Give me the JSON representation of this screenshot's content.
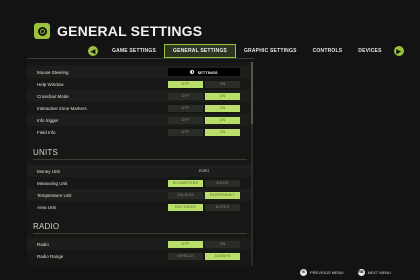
{
  "header": {
    "title": "GENERAL SETTINGS"
  },
  "tabs": {
    "left_nav": "◂",
    "right_nav": "▸",
    "items": [
      {
        "label": "GAME SETTINGS",
        "active": false
      },
      {
        "label": "GENERAL SETTINGS",
        "active": true
      },
      {
        "label": "GRAPHIC SETTINGS",
        "active": false
      },
      {
        "label": "CONTROLS",
        "active": false
      },
      {
        "label": "DEVICES",
        "active": false
      }
    ]
  },
  "general": {
    "mouse_steering": {
      "label": "Mouse Steering",
      "button": "SETTINGS"
    },
    "help_window": {
      "label": "Help Window",
      "off": "OFF",
      "on": "ON",
      "selected": "off"
    },
    "crosshair_mode": {
      "label": "Crosshair Mode",
      "off": "OFF",
      "on": "ON",
      "selected": "on"
    },
    "interactive_zone_markers": {
      "label": "Interactive Zone Markers",
      "off": "OFF",
      "on": "ON",
      "selected": "on"
    },
    "info_trigger": {
      "label": "Info trigger",
      "off": "OFF",
      "on": "ON",
      "selected": "on"
    },
    "field_info": {
      "label": "Field Info",
      "off": "OFF",
      "on": "ON",
      "selected": "on"
    }
  },
  "units": {
    "heading": "UNITS",
    "money_unit": {
      "label": "Money Unit",
      "value": "EURO"
    },
    "measuring_unit": {
      "label": "Measuring Unit",
      "a": "KILOMETERS",
      "b": "MILES",
      "selected": "a"
    },
    "temperature_unit": {
      "label": "Temperature Unit",
      "a": "CELSIUS",
      "b": "FAHRENHEIT",
      "selected": "b"
    },
    "area_unit": {
      "label": "Area Unit",
      "a": "HECTARES",
      "b": "ACRES",
      "selected": "a"
    }
  },
  "radio": {
    "heading": "RADIO",
    "radio": {
      "label": "Radio",
      "off": "OFF",
      "on": "ON",
      "selected": "off"
    },
    "radio_range": {
      "label": "Radio Range",
      "a": "VEHICLE",
      "b": "ALWAYS",
      "selected": "b"
    }
  },
  "footer": {
    "previous_menu": {
      "key": "B",
      "label": "PREVIOUS MENU"
    },
    "next_menu": {
      "key": "RB",
      "label": "NEXT MENU"
    }
  },
  "colors": {
    "accent": "#9ac23c",
    "toggle_on": "#b9de6a",
    "background": "#121312"
  }
}
